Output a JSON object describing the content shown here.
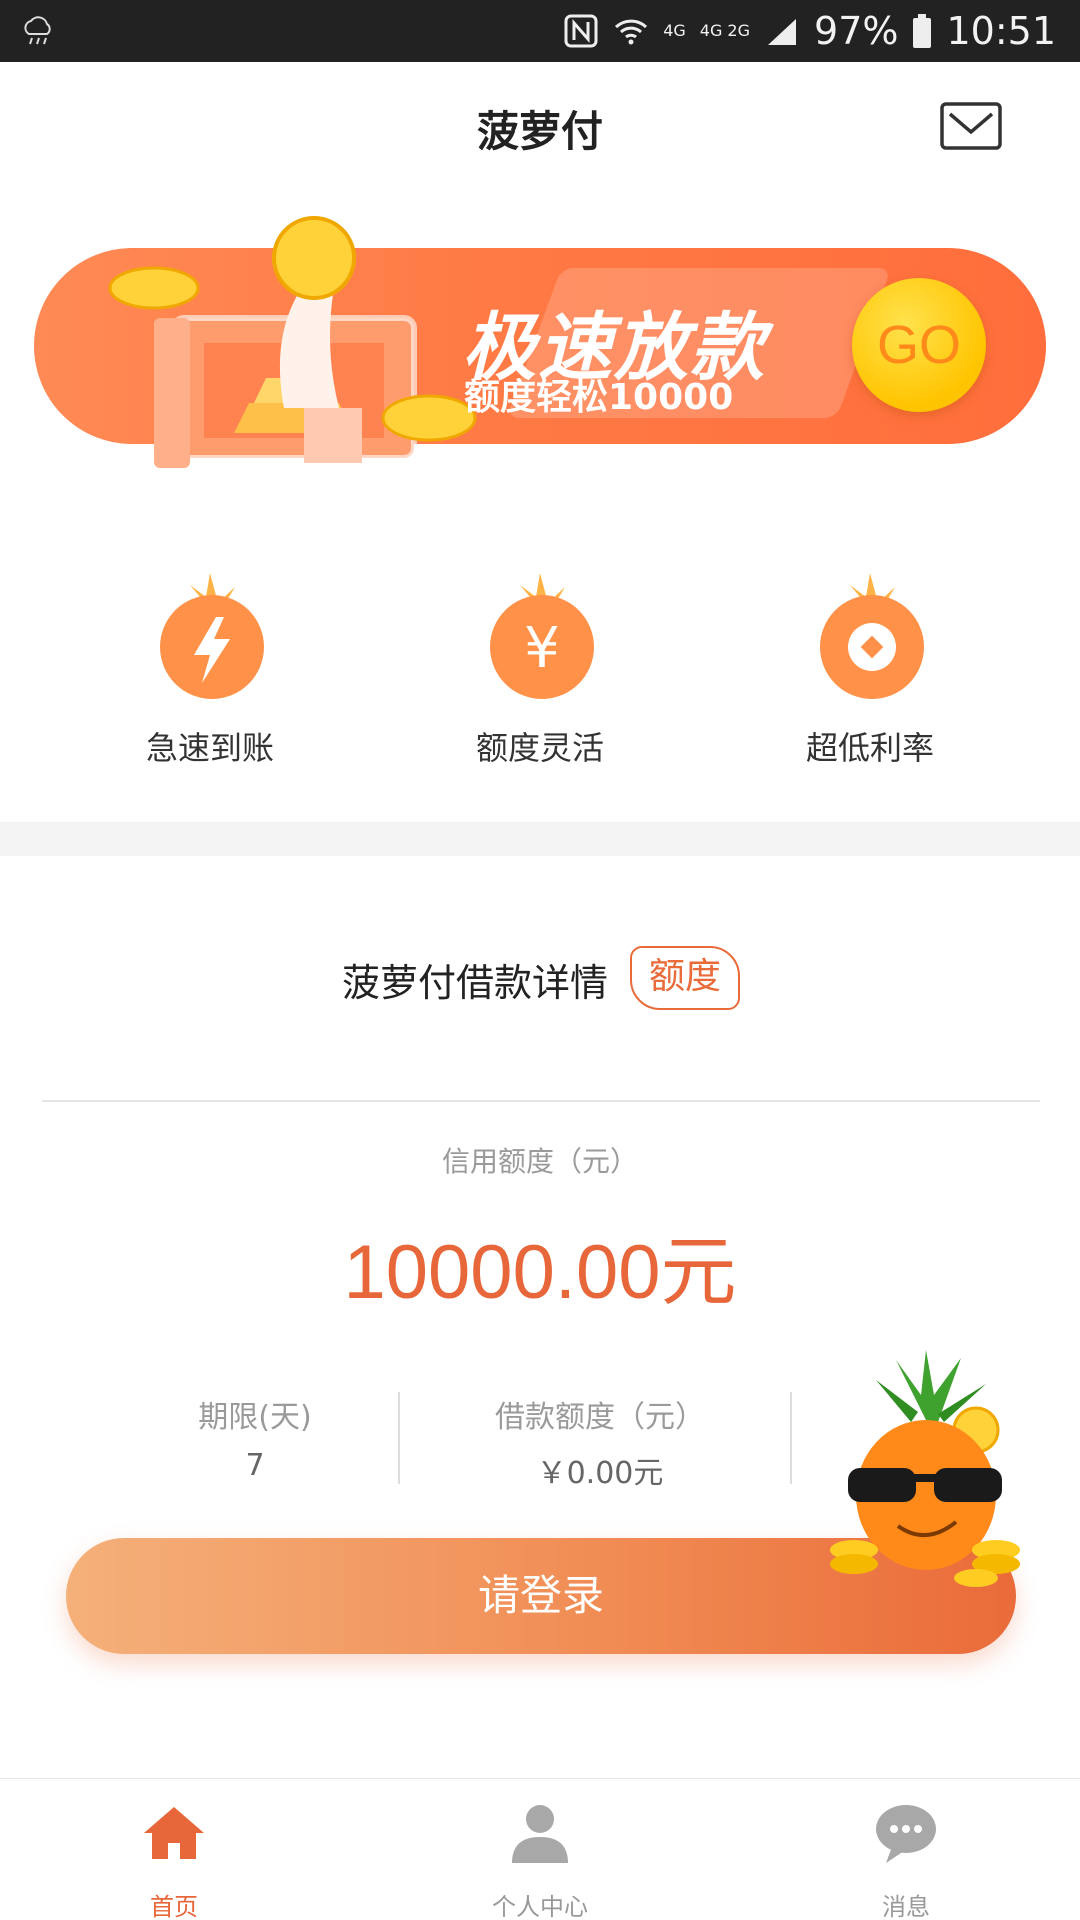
{
  "status_bar": {
    "network_top": "4G",
    "network_bottom": "4G 2G",
    "battery": "97%",
    "time": "10:51",
    "icons": [
      "cloud-rain-icon",
      "nfc-icon",
      "wifi-icon",
      "signal-icon",
      "battery-icon"
    ]
  },
  "header": {
    "title": "菠萝付",
    "mail_icon": "mail-icon"
  },
  "banner": {
    "title": "极速放款",
    "subtitle": "额度轻松10000",
    "go_label": "GO"
  },
  "features": [
    {
      "label": "急速到账",
      "icon": "lightning-icon"
    },
    {
      "label": "额度灵活",
      "icon": "yen-icon"
    },
    {
      "label": "超低利率",
      "icon": "coin-icon"
    }
  ],
  "loan": {
    "title": "菠萝付借款详情",
    "tag": "额度",
    "credit_label": "信用额度（元）",
    "credit_amount": "10000.00元",
    "term_label": "期限(天)",
    "term_value": "7",
    "amount_label": "借款额度（元）",
    "amount_value": "￥0.00元",
    "login_label": "请登录"
  },
  "bottom_nav": [
    {
      "label": "首页",
      "icon": "home-icon",
      "active": true
    },
    {
      "label": "个人中心",
      "icon": "person-icon",
      "active": false
    },
    {
      "label": "消息",
      "icon": "chat-icon",
      "active": false
    }
  ],
  "colors": {
    "accent": "#e8673a",
    "banner": "#ff7a45",
    "gold": "#ffc400"
  }
}
